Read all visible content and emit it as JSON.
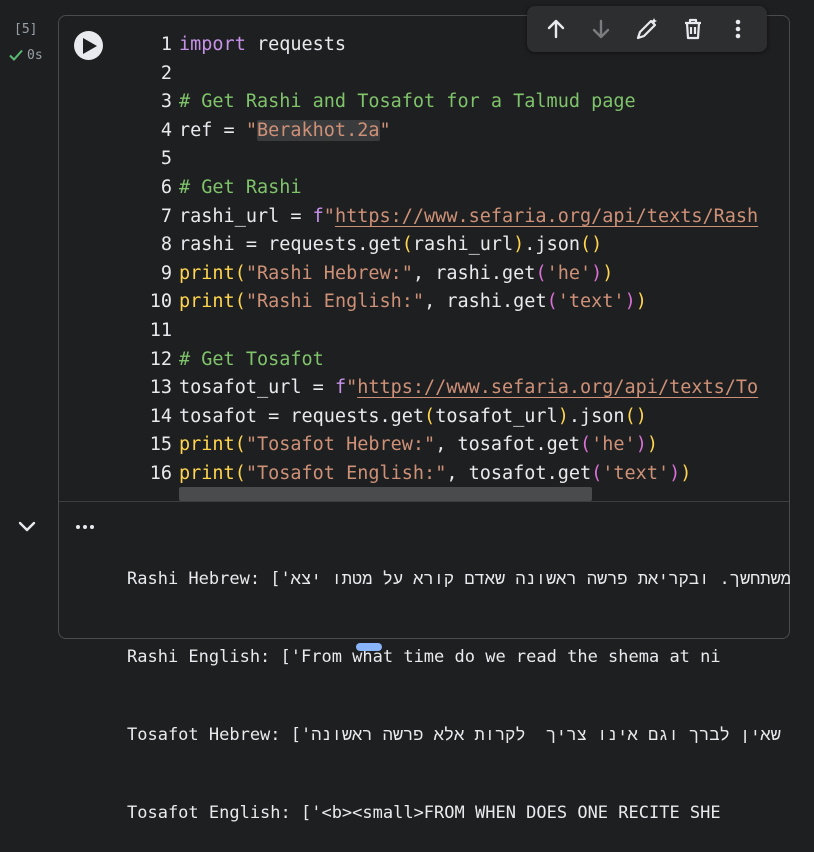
{
  "cell": {
    "execution_count": "[5]",
    "exec_time": "0s"
  },
  "toolbar": {
    "icons": [
      "arrow-up-icon",
      "arrow-down-icon",
      "edit-icon",
      "trash-icon",
      "more-vert-icon"
    ]
  },
  "code_lines": [
    "import requests",
    "",
    "# Get Rashi and Tosafot for a Talmud page",
    "ref = \"Berakhot.2a\"",
    "",
    "# Get Rashi",
    "rashi_url = f\"https://www.sefaria.org/api/texts/Rash",
    "rashi = requests.get(rashi_url).json()",
    "print(\"Rashi Hebrew:\", rashi.get('he'))",
    "print(\"Rashi English:\", rashi.get('text'))",
    "",
    "# Get Tosafot",
    "tosafot_url = f\"https://www.sefaria.org/api/texts/To",
    "tosafot = requests.get(tosafot_url).json()",
    "print(\"Tosafot Hebrew:\", tosafot.get('he'))",
    "print(\"Tosafot English:\", tosafot.get('text'))"
  ],
  "output_lines": [
    "Rashi Hebrew: ['משתחשך. ובקריאת פרשה ראשונה שאדם קורא על מטתו יצא'",
    "Rashi English: ['From what time do we read the shema at ni",
    "Tosafot Hebrew: ['תו שאין לברך וגם אינו צריך  לקרות אלא פרשה ראשונה'",
    "Tosafot English: ['<b><small>FROM WHEN DOES ONE RECITE SHE"
  ]
}
